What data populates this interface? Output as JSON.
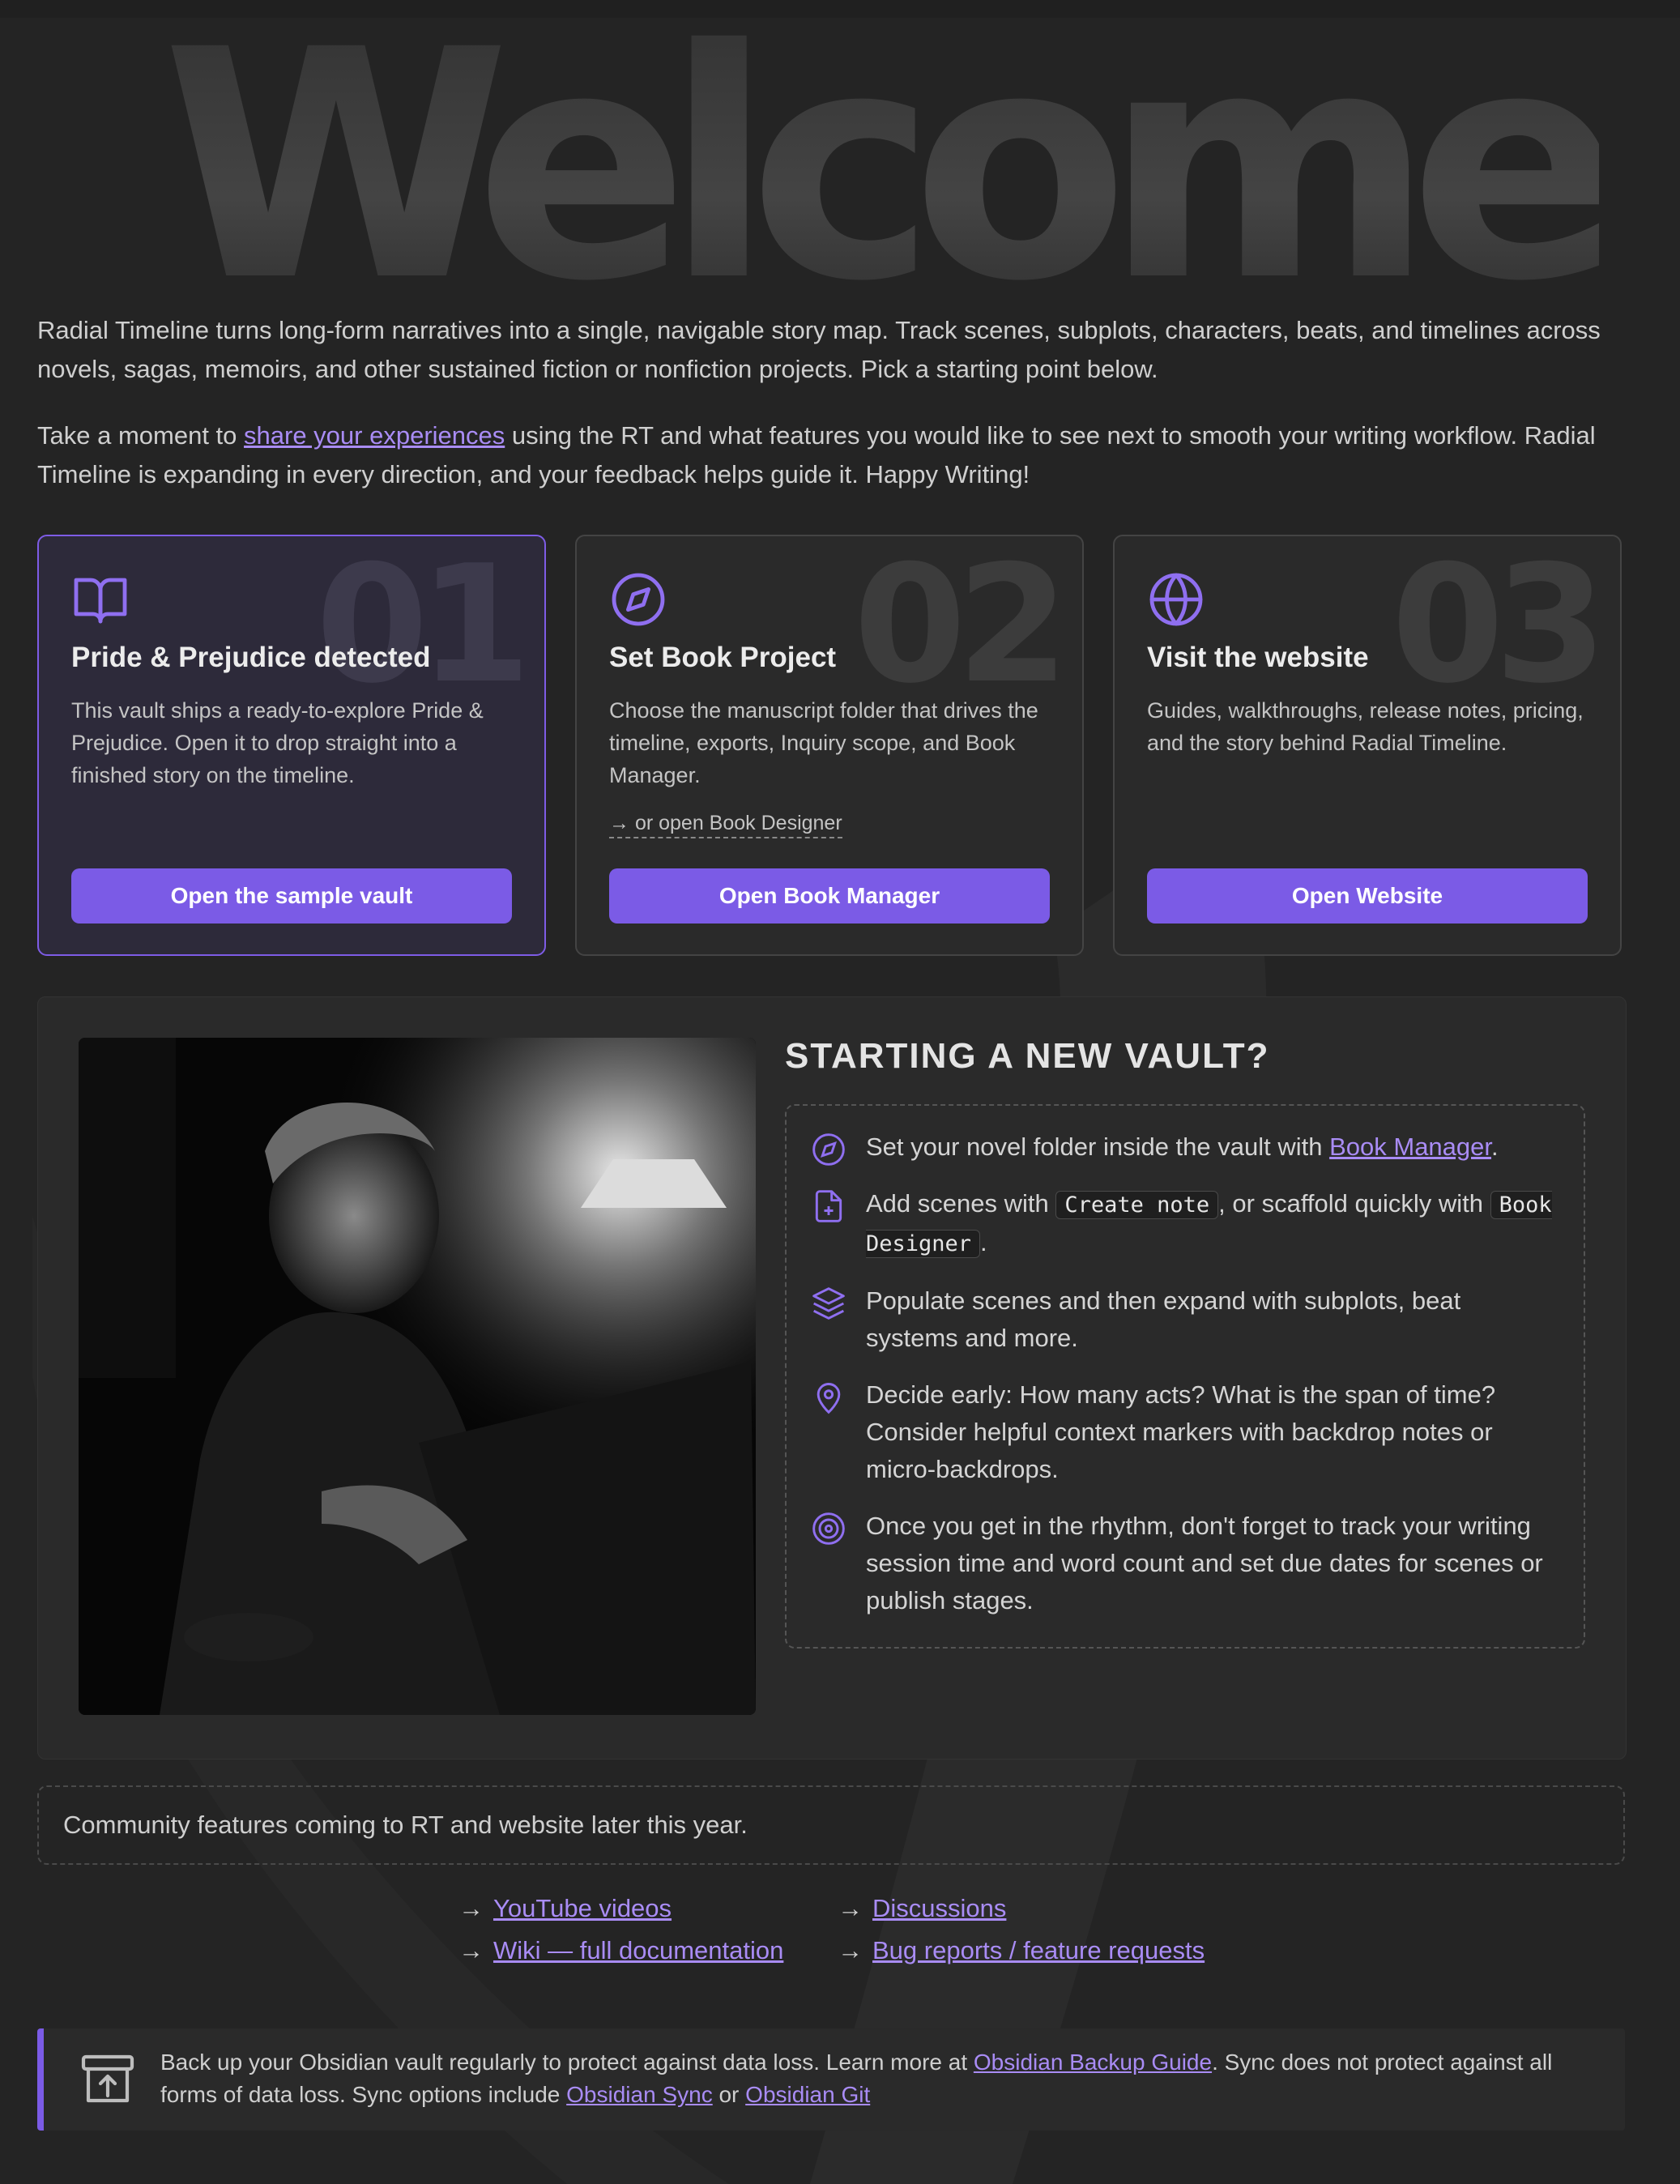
{
  "hero": {
    "title": "Welcome"
  },
  "intro": {
    "p1": "Radial Timeline turns long-form narratives into a single, navigable story map. Track scenes, subplots, characters, beats, and timelines across novels, sagas, memoirs, and other sustained fiction or nonfiction projects. Pick a starting point below.",
    "p2_before": "Take a moment to ",
    "p2_link": "share your experiences",
    "p2_after": " using the RT and what features you would like to see next to smooth your writing workflow. Radial Timeline is expanding in every direction, and your feedback helps guide it. Happy Writing!"
  },
  "cards": [
    {
      "number": "01",
      "icon": "book-open-icon",
      "title": "Pride & Prejudice detected",
      "description": "This vault ships a ready-to-explore Pride & Prejudice. Open it to drop straight into a finished story on the timeline.",
      "button": "Open the sample vault"
    },
    {
      "number": "02",
      "icon": "compass-icon",
      "title": "Set Book Project",
      "description": "Choose the manuscript folder that drives the timeline, exports, Inquiry scope, and Book Manager.",
      "secondary": "→ or open Book Designer",
      "button": "Open Book Manager"
    },
    {
      "number": "03",
      "icon": "globe-icon",
      "title": "Visit the website",
      "description": "Guides, walkthroughs, release notes, pricing, and the story behind Radial Timeline.",
      "button": "Open Website"
    }
  ],
  "new_vault": {
    "heading": "STARTING A NEW VAULT?",
    "steps": {
      "s1_before": "Set your novel folder inside the vault with ",
      "s1_link": "Book Manager",
      "s1_after": ".",
      "s2_before": "Add scenes with ",
      "s2_code1": "Create note",
      "s2_mid": ", or scaffold quickly with ",
      "s2_code2": "Book Designer",
      "s2_after": ".",
      "s3": "Populate scenes and then expand with subplots, beat systems and more.",
      "s4": "Decide early: How many acts? What is the span of time? Consider helpful context markers with backdrop notes or micro-backdrops.",
      "s5": "Once you get in the rhythm, don't forget to track your writing session time and word count and set due dates for scenes or publish stages."
    }
  },
  "community": {
    "text": "Community features coming to RT and website later this year."
  },
  "links": {
    "arrow": "→",
    "youtube": "YouTube videos",
    "wiki": "Wiki — full documentation",
    "discussions": "Discussions",
    "bugs": "Bug reports / feature requests"
  },
  "backup": {
    "t1": "Back up your Obsidian vault regularly to protect against data loss. Learn more at ",
    "link1": "Obsidian Backup Guide",
    "t2": ". Sync does not protect against all forms of data loss. Sync options include ",
    "link2": "Obsidian Sync",
    "t3": " or ",
    "link3": "Obsidian Git"
  },
  "colors": {
    "accent": "#7b5be6",
    "link": "#a98cf5",
    "background": "#242424"
  }
}
